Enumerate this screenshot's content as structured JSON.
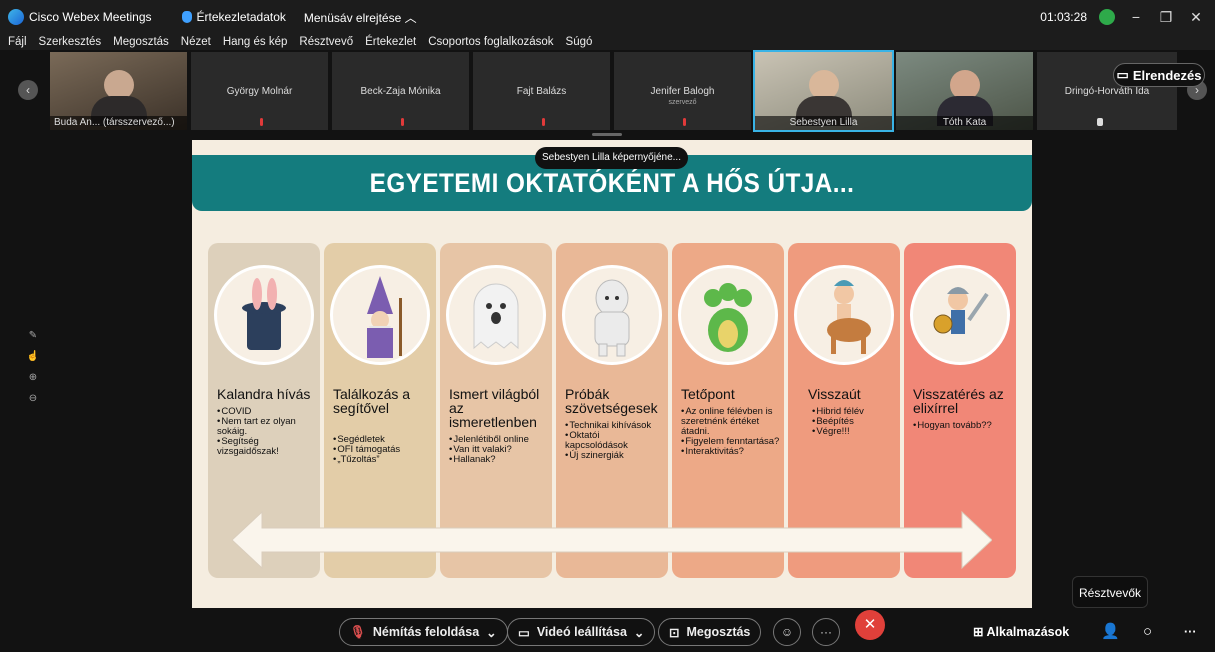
{
  "titlebar": {
    "app_name": "Cisco Webex Meetings",
    "meeting_info": "Értekezletadatok",
    "hide_menu": "Menüsáv elrejtése",
    "time": "01:03:28"
  },
  "menu": [
    "Fájl",
    "Szerkesztés",
    "Megosztás",
    "Nézet",
    "Hang és kép",
    "Résztvevő",
    "Értekezlet",
    "Csoportos foglalkozások",
    "Súgó"
  ],
  "participants": [
    {
      "name": "Buda An... (társszervező...)",
      "sub": ""
    },
    {
      "name": "György Molnár",
      "sub": ""
    },
    {
      "name": "Beck-Zaja Mónika",
      "sub": ""
    },
    {
      "name": "Fajt Balázs",
      "sub": ""
    },
    {
      "name": "Jenifer Balogh",
      "sub": "szervező"
    },
    {
      "name": "Sebestyen Lilla",
      "sub": ""
    },
    {
      "name": "Tóth Kata",
      "sub": ""
    },
    {
      "name": "Dringó-Horváth Ida",
      "sub": ""
    }
  ],
  "layout_label": "Elrendezés",
  "share_indicator": "Sebestyen Lilla képernyőjéne...",
  "slide": {
    "title": "EGYETEMI OKTATÓKÉNT A HŐS ÚTJA...",
    "cards": [
      {
        "title": "Kalandra hívás",
        "items": [
          "COVID",
          "Nem tart ez olyan sokáig.",
          "Segítség vizsgaidőszak!"
        ],
        "color": "#ddd0bb"
      },
      {
        "title": "Találkozás a segítővel",
        "items": [
          "Segédletek",
          "OFI támogatás",
          "„Tűzoltás”"
        ],
        "color": "#e3cda8"
      },
      {
        "title": "Ismert világból az ismeretlenben",
        "items": [
          "Jelenlétiből online",
          "Van itt valaki?",
          "Hallanak?"
        ],
        "color": "#e7c5a6"
      },
      {
        "title": "Próbák szövetségesek",
        "items": [
          "Technikai kihívások",
          "Oktatói kapcsolódások",
          "Új szinergiák"
        ],
        "color": "#e9b897"
      },
      {
        "title": "Tetőpont",
        "items": [
          "Az online félévben is szeretnénk értéket átadni.",
          "Figyelem fenntartása?",
          "Interaktivitás?"
        ],
        "color": "#eda987"
      },
      {
        "title": "Visszaút",
        "items": [
          "Hibrid félév",
          "Beépítés",
          "Végre!!!"
        ],
        "color": "#ef9b7e"
      },
      {
        "title": "Visszatérés az elixírrel",
        "items": [
          "Hogyan tovább??"
        ],
        "color": "#f18777"
      }
    ]
  },
  "tooltip": "Résztvevők",
  "controls": {
    "mute": "Némítás feloldása",
    "video": "Videó leállítása",
    "share": "Megosztás",
    "apps": "Alkalmazások"
  }
}
